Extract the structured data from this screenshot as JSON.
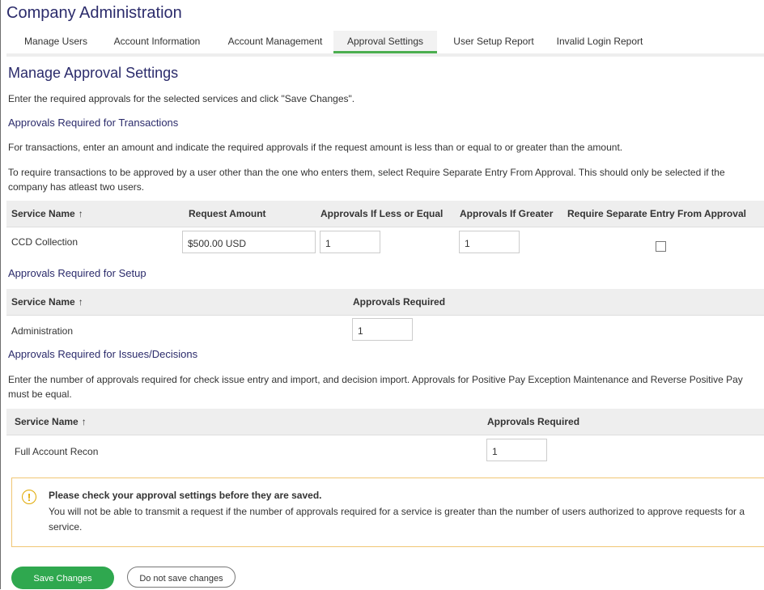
{
  "app": {
    "title": "Company Administration"
  },
  "tabs": [
    {
      "label": "Manage Users"
    },
    {
      "label": "Account Information"
    },
    {
      "label": "Account Management"
    },
    {
      "label": "Approval Settings",
      "active": true
    },
    {
      "label": "User Setup Report"
    },
    {
      "label": "Invalid Login Report"
    }
  ],
  "page": {
    "title": "Manage Approval Settings",
    "intro": "Enter the required approvals for the selected services and click \"Save Changes\"."
  },
  "transactions": {
    "heading": "Approvals Required for Transactions",
    "desc1": "For transactions, enter an amount and indicate the required approvals if the request amount is less than or equal to or greater than the amount.",
    "desc2": "To require transactions to be approved by a user other than the one who enters them, select Require Separate Entry From Approval. This should only be selected if the company has atleast two users.",
    "columns": {
      "service": "Service Name",
      "sort_icon": "↑",
      "amount": "Request Amount",
      "less_equal": "Approvals If Less or Equal",
      "greater": "Approvals If Greater",
      "separate": "Require Separate Entry From Approval"
    },
    "rows": [
      {
        "service": "CCD Collection",
        "amount": "$500.00 USD",
        "less_equal": "1",
        "greater": "1",
        "separate": false
      }
    ]
  },
  "setup": {
    "heading": "Approvals Required for Setup",
    "columns": {
      "service": "Service Name",
      "sort_icon": "↑",
      "approvals": "Approvals Required"
    },
    "rows": [
      {
        "service": "Administration",
        "approvals": "1"
      }
    ]
  },
  "issues": {
    "heading": "Approvals Required for Issues/Decisions",
    "desc": "Enter the number of approvals required for check issue entry and import, and decision import. Approvals for Positive Pay Exception Maintenance and Reverse Positive Pay must be equal.",
    "columns": {
      "service": "Service Name",
      "sort_icon": "↑",
      "approvals": "Approvals Required"
    },
    "rows": [
      {
        "service": "Full Account Recon",
        "approvals": "1"
      }
    ]
  },
  "warning": {
    "icon": "exclamation-icon",
    "icon_glyph": "!",
    "title": "Please check your approval settings before they are saved.",
    "body": "You will not be able to transmit a request if the number of approvals required for a service is greater than the number of users authorized to approve requests for a service."
  },
  "buttons": {
    "save": "Save Changes",
    "cancel": "Do not save changes"
  },
  "colors": {
    "accent": "#4caf50",
    "primary_button": "#2fa84f",
    "heading": "#2b2b6b",
    "warning_border": "#f0c674"
  }
}
